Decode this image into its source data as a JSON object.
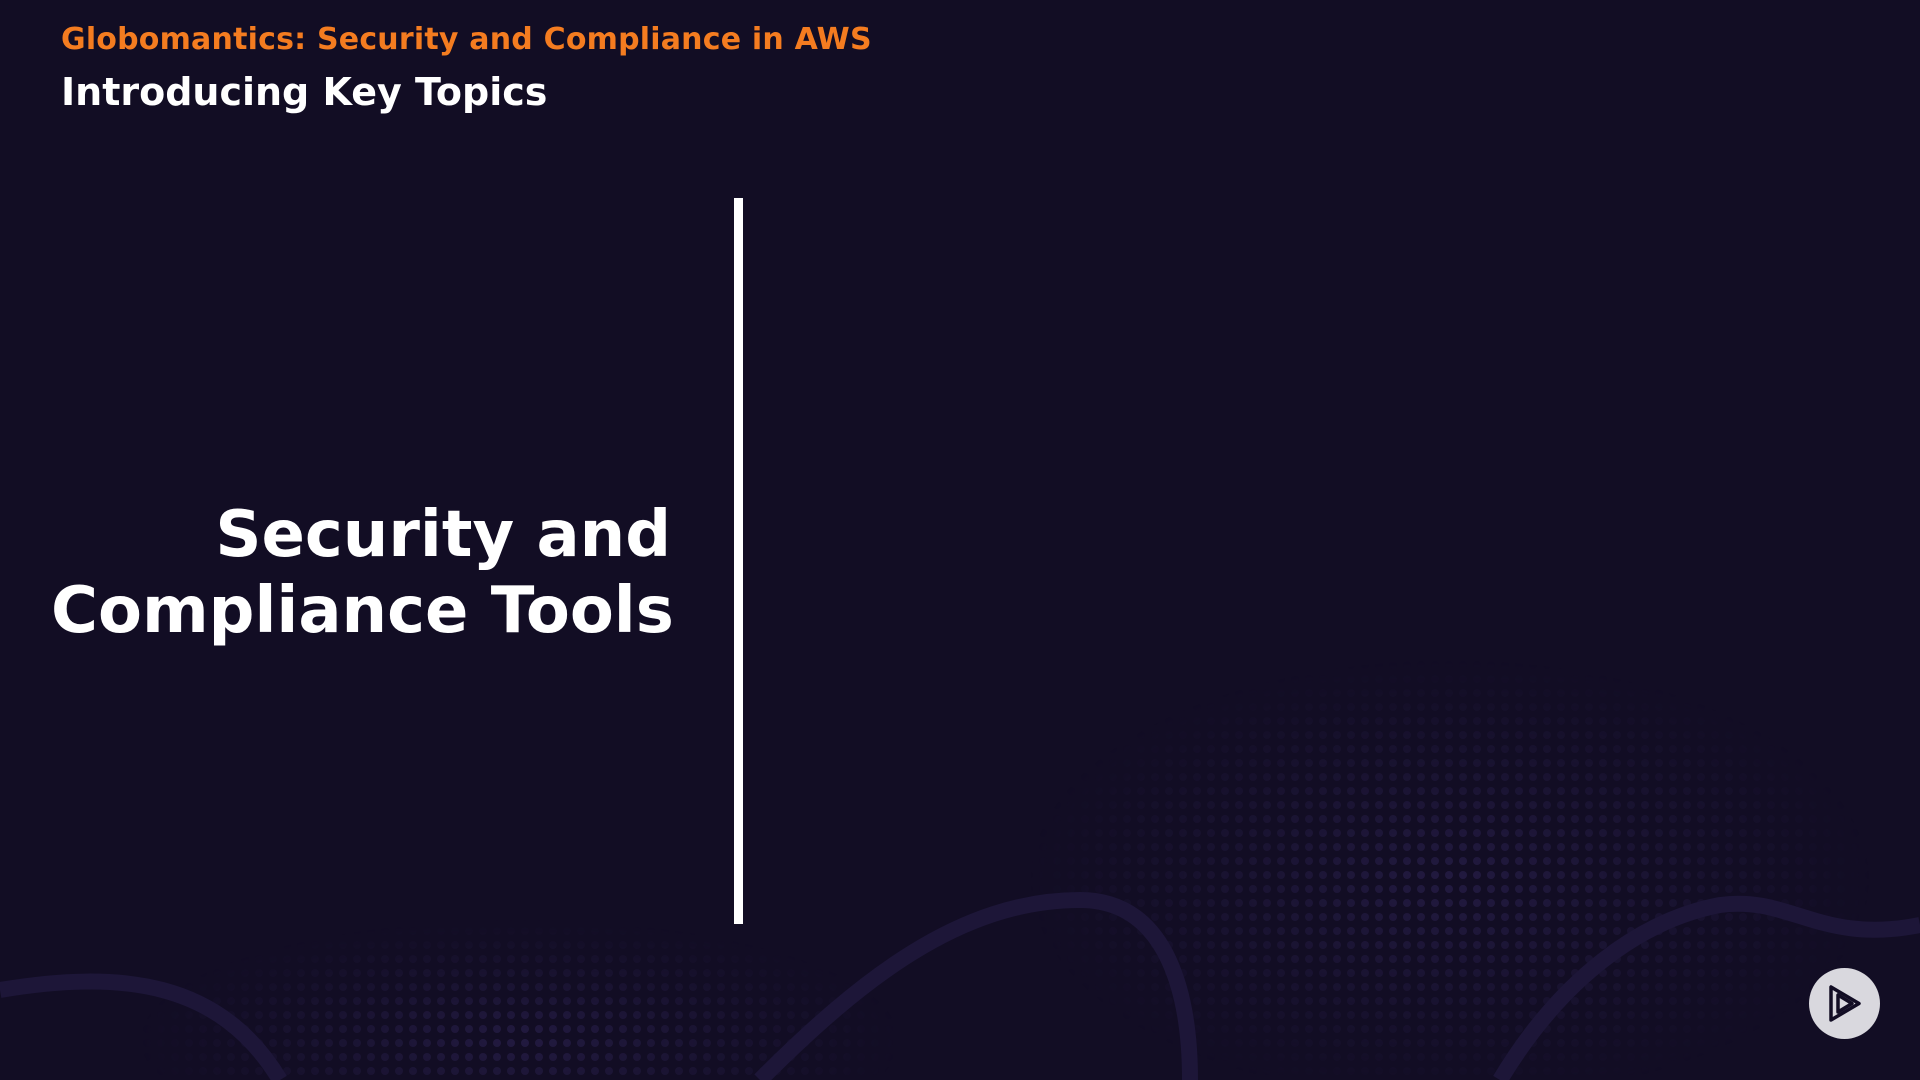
{
  "header": {
    "course_title": "Globomantics: Security and Compliance in AWS",
    "module_title": "Introducing Key Topics"
  },
  "main": {
    "topic_line_1": "Security and",
    "topic_line_2": "Compliance Tools"
  },
  "colors": {
    "background": "#120d24",
    "accent_orange": "#f47c20",
    "text_white": "#ffffff",
    "pattern_purple": "#2a1f4a",
    "badge_gray": "#d9d8de"
  },
  "icons": {
    "corner_badge": "play-logo-icon"
  }
}
